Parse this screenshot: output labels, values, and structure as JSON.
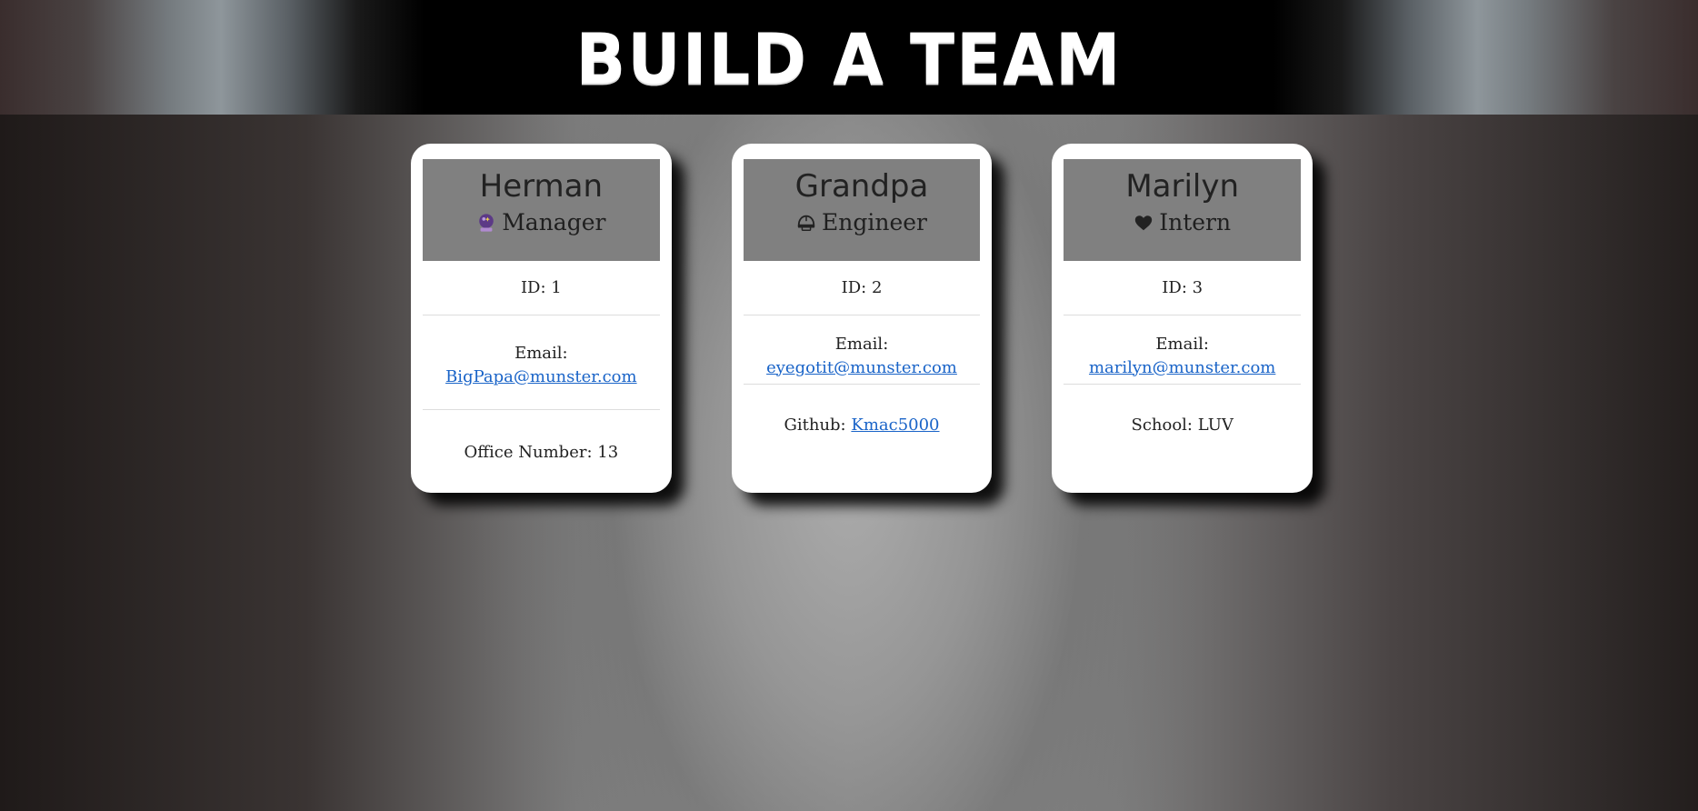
{
  "header": {
    "title": "BUILD A TEAM"
  },
  "cards": [
    {
      "name": "Herman",
      "role": "Manager",
      "role_icon": "crystal-ball-icon",
      "id_label": "ID:",
      "id_value": "1",
      "email_label": "Email:",
      "email_value": "BigPapa@munster.com",
      "extra_label": "Office Number:",
      "extra_value": "13"
    },
    {
      "name": "Grandpa",
      "role": "Engineer",
      "role_icon": "helmet-icon",
      "id_label": "ID:",
      "id_value": "2",
      "email_label": "Email:",
      "email_value": "eyegotit@munster.com",
      "extra_label": "Github:",
      "extra_value": "Kmac5000"
    },
    {
      "name": "Marilyn",
      "role": "Intern",
      "role_icon": "heart-icon",
      "id_label": "ID:",
      "id_value": "3",
      "email_label": "Email:",
      "email_value": "marilyn@munster.com",
      "extra_label": "School:",
      "extra_value": "LUV"
    }
  ],
  "colors": {
    "card_header_bg": "#808080",
    "link": "#1a64c8",
    "card_bg": "#ffffff"
  }
}
